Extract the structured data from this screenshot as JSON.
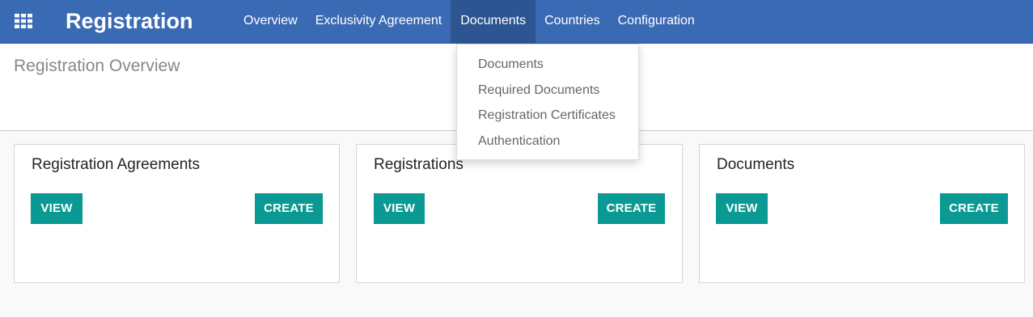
{
  "navbar": {
    "apps_icon": "grid-apps-icon",
    "brand": "Registration",
    "menu": [
      {
        "label": "Overview",
        "active": false
      },
      {
        "label": "Exclusivity Agreement",
        "active": false
      },
      {
        "label": "Documents",
        "active": true
      },
      {
        "label": "Countries",
        "active": false
      },
      {
        "label": "Configuration",
        "active": false
      }
    ],
    "colors": {
      "background": "#3a6ab3",
      "active_item": "#2c5592"
    }
  },
  "control_panel": {
    "title": "Registration Overview"
  },
  "dropdown": {
    "items": [
      {
        "label": "Documents"
      },
      {
        "label": "Required Documents"
      },
      {
        "label": "Registration Certificates"
      },
      {
        "label": "Authentication"
      }
    ]
  },
  "cards": [
    {
      "title": "Registration Agreements",
      "view_label": "VIEW",
      "create_label": "CREATE"
    },
    {
      "title": "Registrations",
      "view_label": "VIEW",
      "create_label": "CREATE"
    },
    {
      "title": "Documents",
      "view_label": "VIEW",
      "create_label": "CREATE"
    }
  ],
  "colors": {
    "button": "#0a9a93",
    "page_background": "#f9f9f9"
  }
}
